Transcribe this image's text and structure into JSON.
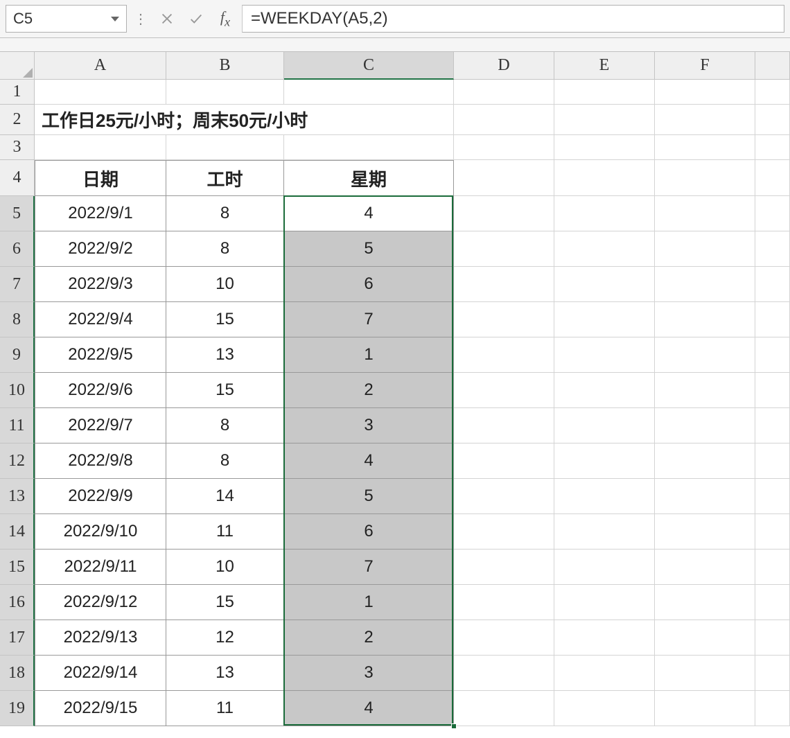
{
  "nameBox": "C5",
  "formula": "=WEEKDAY(A5,2)",
  "columns": [
    "A",
    "B",
    "C",
    "D",
    "E",
    "F"
  ],
  "selectedColumn": "C",
  "rowNumbers": [
    1,
    2,
    3,
    4,
    5,
    6,
    7,
    8,
    9,
    10,
    11,
    12,
    13,
    14,
    15,
    16,
    17,
    18,
    19
  ],
  "selectedRows": [
    5,
    6,
    7,
    8,
    9,
    10,
    11,
    12,
    13,
    14,
    15,
    16,
    17,
    18,
    19
  ],
  "titleText": "工作日25元/小时；周末50元/小时",
  "headers": {
    "A": "日期",
    "B": "工时",
    "C": "星期"
  },
  "rows": [
    {
      "A": "2022/9/1",
      "B": "8",
      "C": "4"
    },
    {
      "A": "2022/9/2",
      "B": "8",
      "C": "5"
    },
    {
      "A": "2022/9/3",
      "B": "10",
      "C": "6"
    },
    {
      "A": "2022/9/4",
      "B": "15",
      "C": "7"
    },
    {
      "A": "2022/9/5",
      "B": "13",
      "C": "1"
    },
    {
      "A": "2022/9/6",
      "B": "15",
      "C": "2"
    },
    {
      "A": "2022/9/7",
      "B": "8",
      "C": "3"
    },
    {
      "A": "2022/9/8",
      "B": "8",
      "C": "4"
    },
    {
      "A": "2022/9/9",
      "B": "14",
      "C": "5"
    },
    {
      "A": "2022/9/10",
      "B": "11",
      "C": "6"
    },
    {
      "A": "2022/9/11",
      "B": "10",
      "C": "7"
    },
    {
      "A": "2022/9/12",
      "B": "15",
      "C": "1"
    },
    {
      "A": "2022/9/13",
      "B": "12",
      "C": "2"
    },
    {
      "A": "2022/9/14",
      "B": "13",
      "C": "3"
    },
    {
      "A": "2022/9/15",
      "B": "11",
      "C": "4"
    }
  ]
}
